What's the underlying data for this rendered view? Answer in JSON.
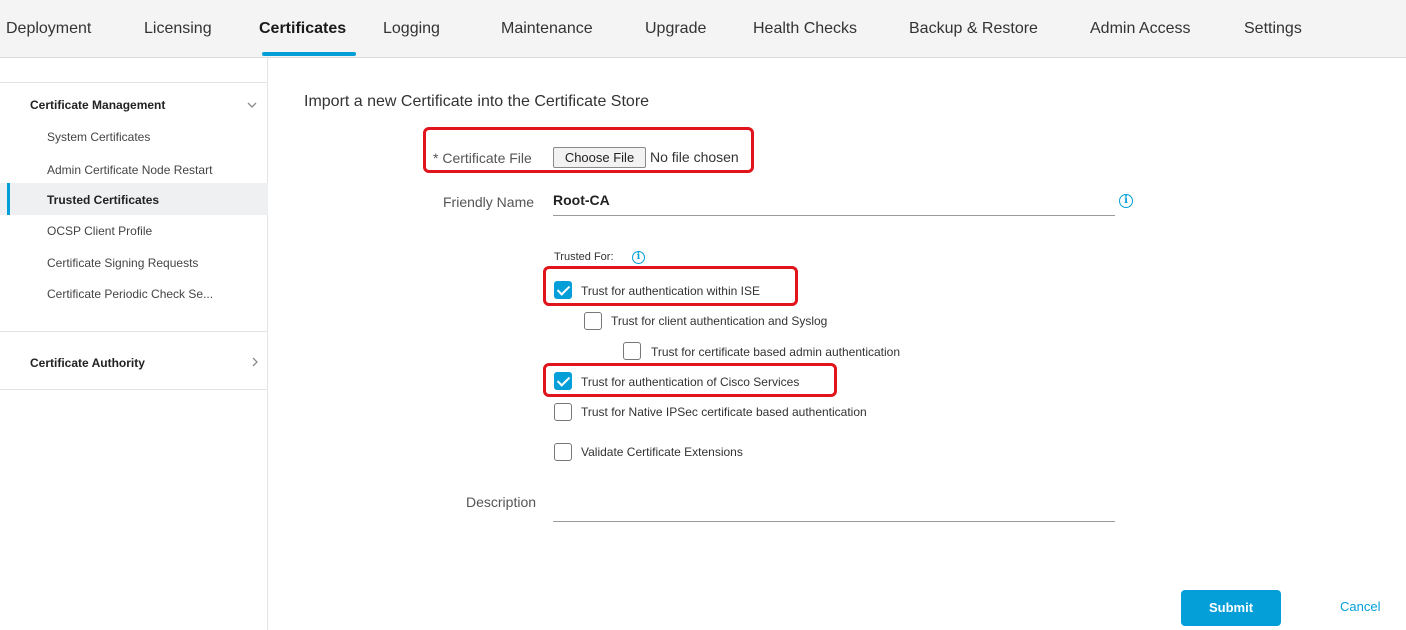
{
  "top_tabs": [
    {
      "label": "Deployment"
    },
    {
      "label": "Licensing"
    },
    {
      "label": "Certificates"
    },
    {
      "label": "Logging"
    },
    {
      "label": "Maintenance"
    },
    {
      "label": "Upgrade"
    },
    {
      "label": "Health Checks"
    },
    {
      "label": "Backup & Restore"
    },
    {
      "label": "Admin Access"
    },
    {
      "label": "Settings"
    }
  ],
  "active_tab": "Certificates",
  "sidebar": {
    "group1": {
      "label": "Certificate Management",
      "chevron": "chevron-down-icon",
      "items": [
        {
          "label": "System Certificates"
        },
        {
          "label": "Admin Certificate Node Restart"
        },
        {
          "label": "Trusted Certificates"
        },
        {
          "label": "OCSP Client Profile"
        },
        {
          "label": "Certificate Signing Requests"
        },
        {
          "label": "Certificate Periodic Check Se..."
        }
      ],
      "active_item": "Trusted Certificates"
    },
    "group2": {
      "label": "Certificate Authority",
      "chevron": "chevron-right-icon"
    }
  },
  "form": {
    "title": "Import a new Certificate into the Certificate Store",
    "certificate_file": {
      "label": "* Certificate File",
      "button_label": "Choose File",
      "status": "No file chosen"
    },
    "friendly_name": {
      "label": "Friendly Name",
      "value": "Root-CA"
    },
    "trusted_for_label": "Trusted For:",
    "options": [
      {
        "label": "Trust for authentication within ISE",
        "checked": true
      },
      {
        "label": "Trust for client authentication and Syslog",
        "checked": false
      },
      {
        "label": "Trust for certificate based admin authentication",
        "checked": false
      },
      {
        "label": "Trust for authentication of Cisco Services",
        "checked": true
      },
      {
        "label": "Trust for Native IPSec certificate based authentication",
        "checked": false
      },
      {
        "label": "Validate Certificate Extensions",
        "checked": false
      }
    ],
    "description": {
      "label": "Description",
      "value": ""
    },
    "submit_label": "Submit",
    "cancel_label": "Cancel"
  },
  "colors": {
    "accent": "#049fd9",
    "highlight_box": "#e1141b",
    "topbar_bg": "#f4f4f4"
  }
}
